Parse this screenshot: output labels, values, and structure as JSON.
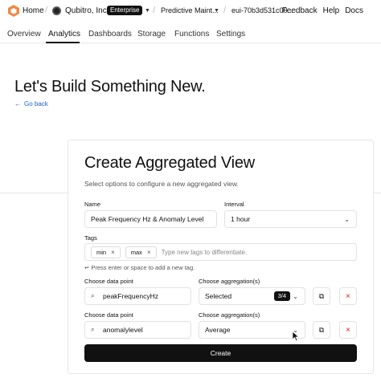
{
  "topbar": {
    "home_label": "Home",
    "org_name": "Qubitro, Inc.",
    "org_badge": "Enterprise",
    "project": "Predictive Maint...",
    "device": "eui-70b3d531c00...",
    "links": [
      "Feedback",
      "Help",
      "Docs"
    ]
  },
  "tabs": [
    {
      "label": "Overview"
    },
    {
      "label": "Analytics"
    },
    {
      "label": "Dashboards"
    },
    {
      "label": "Storage"
    },
    {
      "label": "Functions"
    },
    {
      "label": "Settings"
    }
  ],
  "page": {
    "title": "Let's Build Something New.",
    "back_label": "Go back"
  },
  "form": {
    "title": "Create Aggregated View",
    "subtitle": "Select options to configure a new aggregated view.",
    "name_label": "Name",
    "name_value": "Peak Frequency Hz & Anomaly Level",
    "interval_label": "Interval",
    "interval_value": "1 hour",
    "tags_label": "Tags",
    "tags": [
      "min",
      "max"
    ],
    "tags_placeholder": "Type new tags to differentiate.",
    "tags_hint": "Press enter or space to add a new tag.",
    "rows": [
      {
        "dp_label": "Choose data point",
        "dp_value": "peakFrequencyHz",
        "agg_label": "Choose aggregation(s)",
        "agg_value": "Selected",
        "agg_count": "3/4"
      },
      {
        "dp_label": "Choose data point",
        "dp_value": "anomalylevel",
        "agg_label": "Choose aggregation(s)",
        "agg_value": "Average"
      }
    ],
    "create_label": "Create"
  },
  "colors": {
    "accent_link": "#1f5fd1",
    "delete_red": "#d81c1c",
    "logo_orange": "#f08a45"
  }
}
